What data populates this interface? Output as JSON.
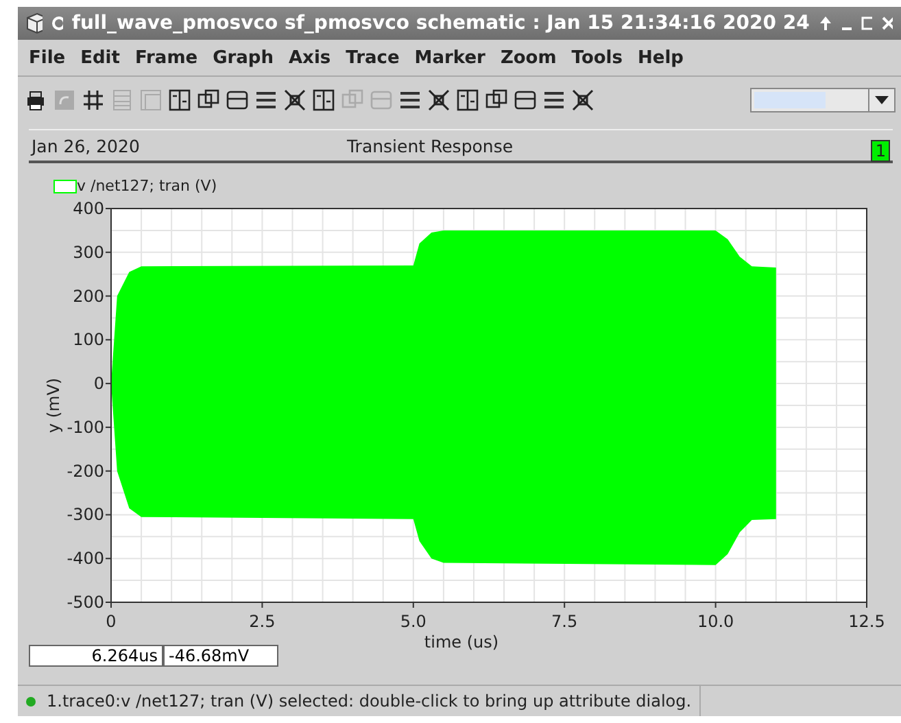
{
  "window": {
    "title": "full_wave_pmosvco sf_pmosvco schematic : Jan 15 21:34:16 2020 24"
  },
  "menu": [
    "File",
    "Edit",
    "Frame",
    "Graph",
    "Axis",
    "Trace",
    "Marker",
    "Zoom",
    "Tools",
    "Help"
  ],
  "toolbar": [
    {
      "disabled": false
    },
    {
      "disabled": true
    },
    {
      "disabled": false
    },
    {
      "disabled": true
    },
    {
      "disabled": true
    },
    {
      "disabled": false
    },
    {
      "disabled": false
    },
    {
      "disabled": false
    },
    {
      "disabled": false
    },
    {
      "disabled": false
    },
    {
      "disabled": false
    },
    {
      "disabled": true
    },
    {
      "disabled": true
    },
    {
      "disabled": false
    },
    {
      "disabled": false
    },
    {
      "disabled": false
    },
    {
      "disabled": false
    },
    {
      "disabled": false
    },
    {
      "disabled": false
    },
    {
      "disabled": false
    }
  ],
  "graph": {
    "date": "Jan 26, 2020",
    "title": "Transient Response",
    "subwindow": "1",
    "chart_data": {
      "type": "area",
      "grid": true,
      "xlabel": "time (us)",
      "ylabel": "y (mV)",
      "x": [
        0,
        0.1,
        0.3,
        0.5,
        5.0,
        5.1,
        5.3,
        5.5,
        10.0,
        10.2,
        10.4,
        10.6,
        11.0
      ],
      "series": [
        {
          "name": "v /net127; tran (V)",
          "color": "#00ff00",
          "values": [
            0,
            200,
            255,
            268,
            270,
            320,
            345,
            350,
            350,
            330,
            290,
            268,
            265
          ]
        },
        {
          "color": "#00ff00",
          "values": [
            0,
            -200,
            -285,
            -305,
            -310,
            -360,
            -400,
            -410,
            -415,
            -390,
            -340,
            -312,
            -310
          ]
        }
      ],
      "xlim": [
        0,
        12.5
      ],
      "ylim": [
        -500,
        400
      ],
      "xticks": [
        0,
        {
          "value": 2.5,
          "label": "2.5"
        },
        {
          "value": 5,
          "label": "5.0"
        },
        {
          "value": 7.5,
          "label": "7.5"
        },
        {
          "value": 10,
          "label": "10.0"
        },
        {
          "value": 12.5,
          "label": "12.5"
        }
      ],
      "yticks": [
        -500,
        -400,
        -300,
        -200,
        -100,
        0,
        100,
        200,
        300,
        400
      ]
    },
    "cursor_x": "6.264us",
    "cursor_y": "-46.68mV"
  },
  "status": {
    "message": "1.trace0:v /net127; tran (V) selected: double-click to bring up attribute dialog.",
    "color": "#22aa22"
  }
}
